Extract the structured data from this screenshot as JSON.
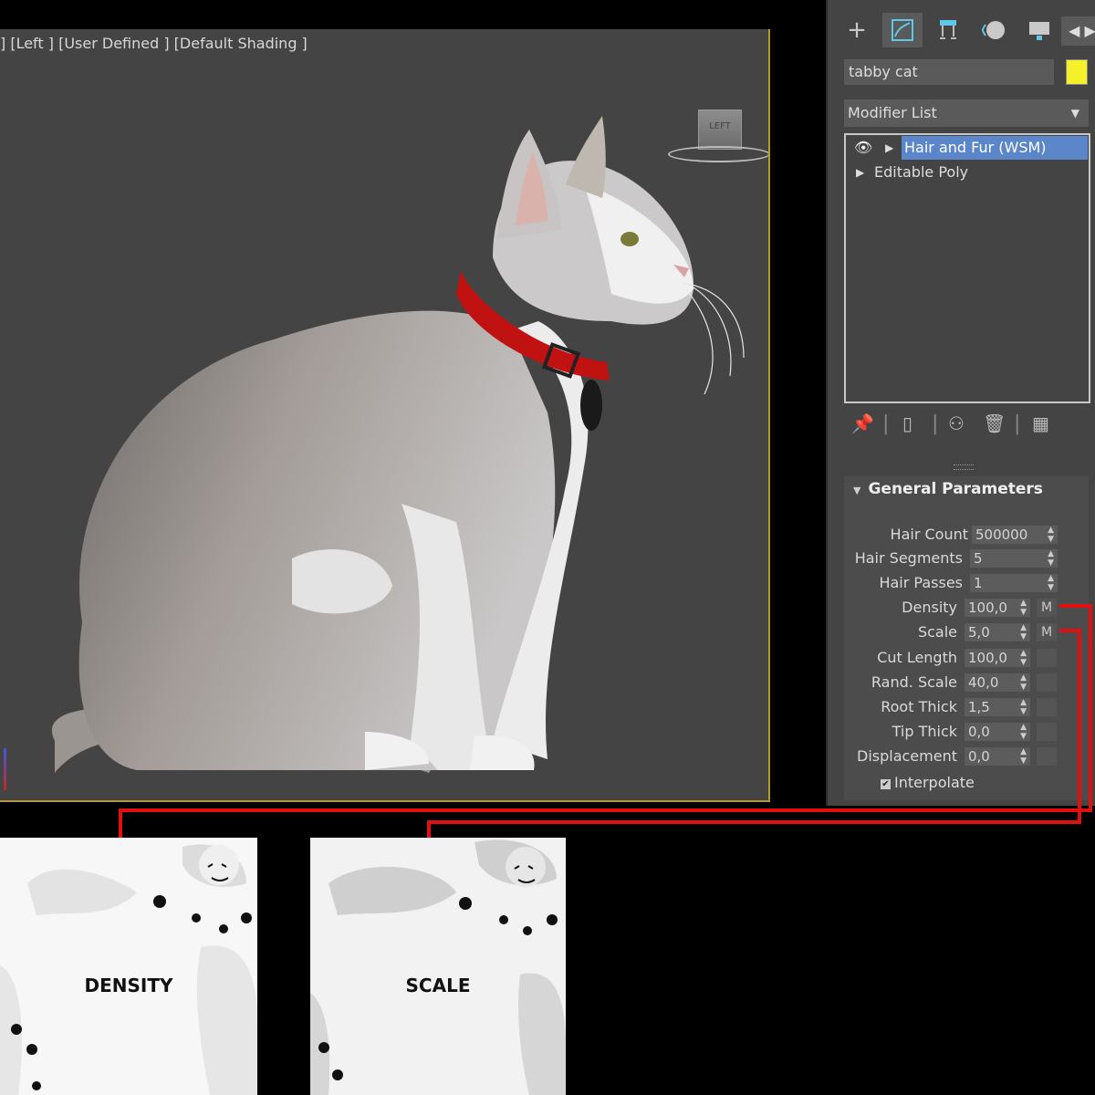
{
  "viewport": {
    "label": "] [Left ] [User Defined ] [Default Shading ]",
    "viewcube_label": "LEFT"
  },
  "command_panel": {
    "tabs": [
      "create-icon",
      "modify-icon",
      "hierarchy-icon",
      "motion-icon",
      "display-icon"
    ],
    "object_name": "tabby cat",
    "object_color": "#f4f02a",
    "modifier_list_label": "Modifier List",
    "stack": [
      {
        "label": "Hair and Fur (WSM)",
        "selected": true
      },
      {
        "label": "Editable Poly",
        "selected": false
      }
    ]
  },
  "general_parameters": {
    "title": "General Parameters",
    "params": [
      {
        "label": "Hair Count",
        "value": "500000"
      },
      {
        "label": "Hair Segments",
        "value": "5"
      },
      {
        "label": "Hair Passes",
        "value": "1"
      },
      {
        "label": "Density",
        "value": "100,0",
        "map_button": "M"
      },
      {
        "label": "Scale",
        "value": "5,0",
        "map_button": "M"
      },
      {
        "label": "Cut Length",
        "value": "100,0"
      },
      {
        "label": "Rand. Scale",
        "value": "40,0"
      },
      {
        "label": "Root Thick",
        "value": "1,5"
      },
      {
        "label": "Tip Thick",
        "value": "0,0"
      },
      {
        "label": "Displacement",
        "value": "0,0"
      }
    ],
    "interpolate_label": "Interpolate",
    "interpolate_checked": true
  },
  "maps": {
    "density_label": "DENSITY",
    "scale_label": "SCALE",
    "link_color": "#e01010"
  }
}
